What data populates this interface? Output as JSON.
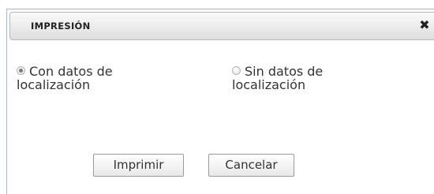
{
  "dialog": {
    "title": "IMPRESIÓN",
    "close_icon": "close-icon",
    "close_glyph": "✖"
  },
  "options": [
    {
      "line1": "Con datos de",
      "line2": "localización",
      "checked": true
    },
    {
      "line1": "Sin datos de",
      "line2": "localización",
      "checked": false
    }
  ],
  "buttons": {
    "print_label": "Imprimir",
    "cancel_label": "Cancelar"
  }
}
